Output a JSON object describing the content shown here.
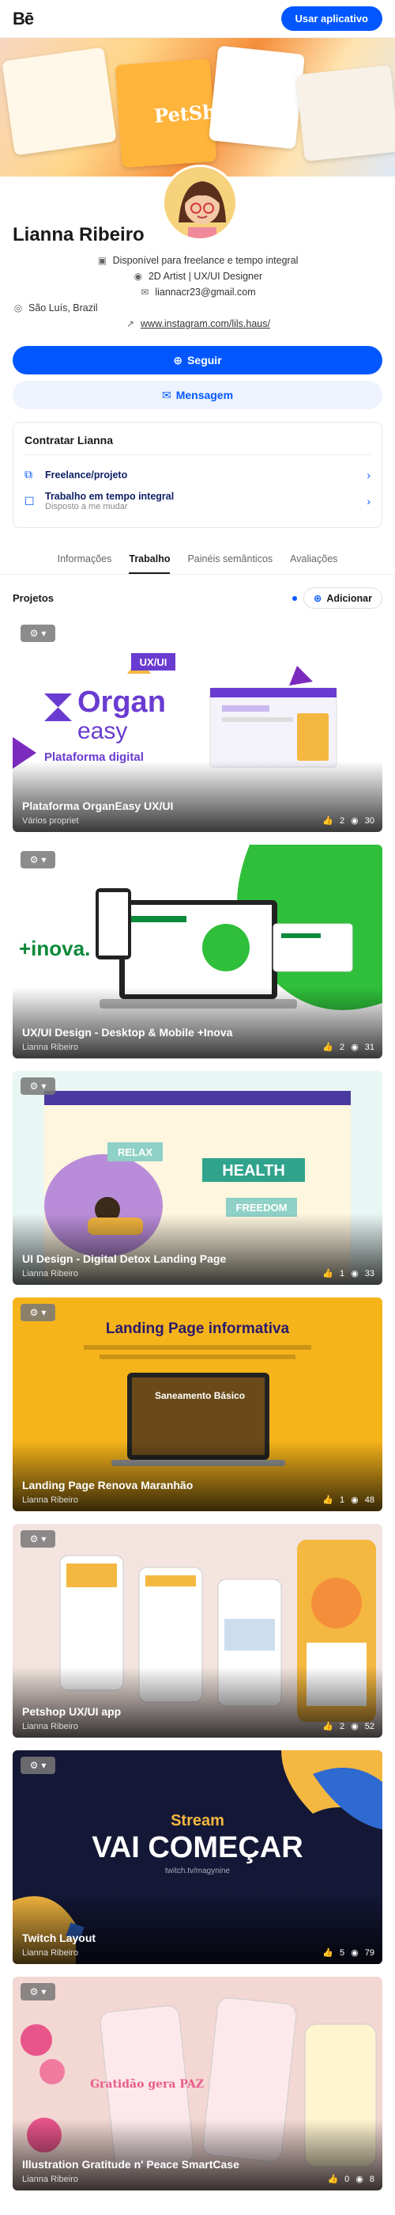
{
  "topbar": {
    "logo": "Bē",
    "cta": "Usar aplicativo"
  },
  "banner": {
    "headline": "PetShop"
  },
  "profile": {
    "name": "Lianna Ribeiro",
    "availability": "Disponível para freelance e tempo integral",
    "role": "2D Artist | UX/UI Designer",
    "email": "liannacr23@gmail.com",
    "location": "São Luís, Brazil",
    "link": "www.instagram.com/lils.haus/"
  },
  "actions": {
    "follow": "Seguir",
    "message": "Mensagem"
  },
  "hire": {
    "title": "Contratar Lianna",
    "items": [
      {
        "title": "Freelance/projeto",
        "sub": ""
      },
      {
        "title": "Trabalho em tempo integral",
        "sub": "Disposto a me mudar"
      }
    ]
  },
  "tabs": [
    "Informações",
    "Trabalho",
    "Painéis semânticos",
    "Avaliações"
  ],
  "projects_label": "Projetos",
  "add_label": "Adicionar",
  "projects": [
    {
      "title": "Plataforma OrganEasy UX/UI",
      "author": "Vários propriet",
      "likes": "2",
      "views": "30"
    },
    {
      "title": "UX/UI Design - Desktop & Mobile +Inova",
      "author": "Lianna Ribeiro",
      "likes": "2",
      "views": "31"
    },
    {
      "title": "UI Design - Digital Detox Landing Page",
      "author": "Lianna Ribeiro",
      "likes": "1",
      "views": "33"
    },
    {
      "title": "Landing Page Renova Maranhão",
      "author": "Lianna Ribeiro",
      "likes": "1",
      "views": "48"
    },
    {
      "title": "Petshop UX/UI app",
      "author": "Lianna Ribeiro",
      "likes": "2",
      "views": "52"
    },
    {
      "title": "Twitch Layout",
      "author": "Lianna Ribeiro",
      "likes": "5",
      "views": "79"
    },
    {
      "title": "Illustration Gratitude n' Peace SmartCase",
      "author": "Lianna Ribeiro",
      "likes": "0",
      "views": "8"
    }
  ],
  "art": {
    "organ_tag": "UX/UI",
    "organ_logo_a": "Organ",
    "organ_logo_b": "easy",
    "organ_sub": "Plataforma digital",
    "inova": "+inova.",
    "relax": "RELAX",
    "health": "HEALTH",
    "freedom": "FREEDOM",
    "lp_title": "Landing Page informativa",
    "lp_card": "Saneamento Básico",
    "stream_a": "Stream",
    "stream_b": "VAI COMEÇAR",
    "stream_c": "twitch.tv/magynine",
    "grat": "Gratidão gera PAZ"
  },
  "colors": {
    "accent": "#0057ff",
    "follow_bg": "#0057ff",
    "msg_bg": "#eef3ff"
  }
}
